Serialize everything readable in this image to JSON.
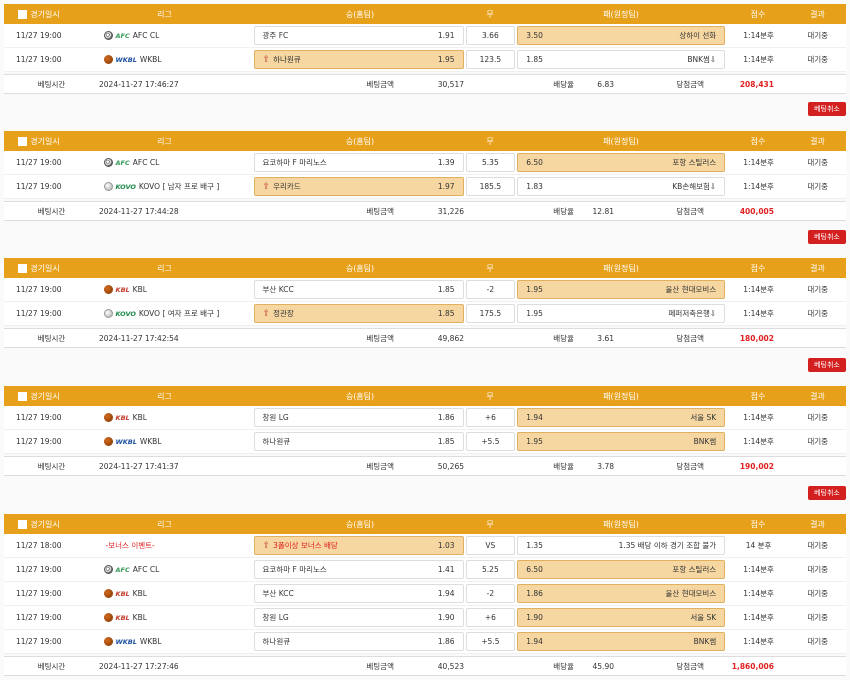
{
  "headers": {
    "date": "경기일시",
    "league": "리그",
    "home": "승(홈팀)",
    "draw": "무",
    "away": "패(원정팀)",
    "score": "점수",
    "result": "결과"
  },
  "summary_labels": {
    "bet_time": "베팅시간",
    "bet_amount": "베팅금액",
    "odds": "배당율",
    "win_amount": "당첨금액"
  },
  "cancel_label": "베팅취소",
  "slips": [
    {
      "rows": [
        {
          "time": "11/27 19:00",
          "ball": "soccer",
          "logo": "afc",
          "logo_text": "AFC",
          "league": "AFC CL",
          "home": "광주 FC",
          "home_odds": "1.91",
          "draw": "3.66",
          "away_odds": "3.50",
          "away": "상하이 선화",
          "home_sel": false,
          "away_sel": true,
          "score": "1:14분후",
          "result": "대기중"
        },
        {
          "time": "11/27 19:00",
          "ball": "basket",
          "logo": "wkbl",
          "logo_text": "WKBL",
          "league": "WKBL",
          "home": "하나원큐",
          "home_odds": "1.95",
          "draw": "123.5",
          "away_odds": "1.85",
          "away": "BNK썸⇩",
          "home_sel": true,
          "away_sel": false,
          "score": "1:14분후",
          "result": "대기중"
        }
      ],
      "bet_time": "2024-11-27 17:46:27",
      "bet_amount": "30,517",
      "odds": "6.83",
      "win_amount": "208,431"
    },
    {
      "rows": [
        {
          "time": "11/27 19:00",
          "ball": "soccer",
          "logo": "afc",
          "logo_text": "AFC",
          "league": "AFC CL",
          "home": "요코하마 F 마리노스",
          "home_odds": "1.39",
          "draw": "5.35",
          "away_odds": "6.50",
          "away": "포항 스틸러스",
          "home_sel": false,
          "away_sel": true,
          "score": "1:14분후",
          "result": "대기중"
        },
        {
          "time": "11/27 19:00",
          "ball": "volley",
          "logo": "kovo",
          "logo_text": "KOVO",
          "league": "KOVO [ 남자 프로 배구 ]",
          "home": "우리카드",
          "home_odds": "1.97",
          "draw": "185.5",
          "away_odds": "1.83",
          "away": "KB손해보험⇩",
          "home_sel": true,
          "away_sel": false,
          "score": "1:14분후",
          "result": "대기중"
        }
      ],
      "bet_time": "2024-11-27 17:44:28",
      "bet_amount": "31,226",
      "odds": "12.81",
      "win_amount": "400,005"
    },
    {
      "rows": [
        {
          "time": "11/27 19:00",
          "ball": "basket",
          "logo": "kbl",
          "logo_text": "KBL",
          "league": "KBL",
          "home": "부산 KCC",
          "home_odds": "1.85",
          "draw": "-2",
          "away_odds": "1.95",
          "away": "울산 현대모비스",
          "home_sel": false,
          "away_sel": true,
          "score": "1:14분후",
          "result": "대기중"
        },
        {
          "time": "11/27 19:00",
          "ball": "volley",
          "logo": "kovo",
          "logo_text": "KOVO",
          "league": "KOVO [ 여자 프로 배구 ]",
          "home": "정관장",
          "home_odds": "1.85",
          "draw": "175.5",
          "away_odds": "1.95",
          "away": "페퍼저축은행⇩",
          "home_sel": true,
          "away_sel": false,
          "score": "1:14분후",
          "result": "대기중"
        }
      ],
      "bet_time": "2024-11-27 17:42:54",
      "bet_amount": "49,862",
      "odds": "3.61",
      "win_amount": "180,002"
    },
    {
      "rows": [
        {
          "time": "11/27 19:00",
          "ball": "basket",
          "logo": "kbl",
          "logo_text": "KBL",
          "league": "KBL",
          "home": "창원 LG",
          "home_odds": "1.86",
          "draw": "+6",
          "away_odds": "1.94",
          "away": "서울 SK",
          "home_sel": false,
          "away_sel": true,
          "score": "1:14분후",
          "result": "대기중"
        },
        {
          "time": "11/27 19:00",
          "ball": "basket",
          "logo": "wkbl",
          "logo_text": "WKBL",
          "league": "WKBL",
          "home": "하나원큐",
          "home_odds": "1.85",
          "draw": "+5.5",
          "away_odds": "1.95",
          "away": "BNK썸",
          "home_sel": false,
          "away_sel": true,
          "score": "1:14분후",
          "result": "대기중"
        }
      ],
      "bet_time": "2024-11-27 17:41:37",
      "bet_amount": "50,265",
      "odds": "3.78",
      "win_amount": "190,002"
    },
    {
      "rows": [
        {
          "time": "11/27 18:00",
          "ball": "",
          "logo": "",
          "logo_text": "",
          "league": "-보너스 이벤트-",
          "league_red": true,
          "home": "3폴이상 보너스 배당",
          "home_red": true,
          "home_odds": "1.03",
          "draw": "VS",
          "away_odds": "1.35",
          "away": "1.35 배당 이하 경기 조합 불가",
          "home_sel": true,
          "away_sel": false,
          "score": "14 분후",
          "result": "대기중"
        },
        {
          "time": "11/27 19:00",
          "ball": "soccer",
          "logo": "afc",
          "logo_text": "AFC",
          "league": "AFC CL",
          "home": "요코하마 F 마리노스",
          "home_odds": "1.41",
          "draw": "5.25",
          "away_odds": "6.50",
          "away": "포항 스틸러스",
          "home_sel": false,
          "away_sel": true,
          "score": "1:14분후",
          "result": "대기중"
        },
        {
          "time": "11/27 19:00",
          "ball": "basket",
          "logo": "kbl",
          "logo_text": "KBL",
          "league": "KBL",
          "home": "부산 KCC",
          "home_odds": "1.94",
          "draw": "-2",
          "away_odds": "1.86",
          "away": "울산 현대모비스",
          "home_sel": false,
          "away_sel": true,
          "score": "1:14분후",
          "result": "대기중"
        },
        {
          "time": "11/27 19:00",
          "ball": "basket",
          "logo": "kbl",
          "logo_text": "KBL",
          "league": "KBL",
          "home": "창원 LG",
          "home_odds": "1.90",
          "draw": "+6",
          "away_odds": "1.90",
          "away": "서울 SK",
          "home_sel": false,
          "away_sel": true,
          "score": "1:14분후",
          "result": "대기중"
        },
        {
          "time": "11/27 19:00",
          "ball": "basket",
          "logo": "wkbl",
          "logo_text": "WKBL",
          "league": "WKBL",
          "home": "하나원큐",
          "home_odds": "1.86",
          "draw": "+5.5",
          "away_odds": "1.94",
          "away": "BNK썸",
          "home_sel": false,
          "away_sel": true,
          "score": "1:14분후",
          "result": "대기중"
        }
      ],
      "bet_time": "2024-11-27 17:27:46",
      "bet_amount": "40,523",
      "odds": "45.90",
      "win_amount": "1,860,006"
    }
  ]
}
